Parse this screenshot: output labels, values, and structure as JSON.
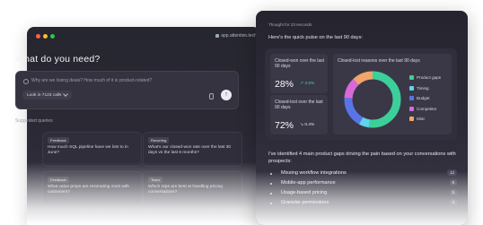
{
  "left_window": {
    "url": "app.attention.tech",
    "heading": "What do you need?",
    "ask_placeholder": "Why are we losing deals? How much of it is product-related?",
    "scope_button": "Look in 7123 calls",
    "send_icon": "arrow-up-icon",
    "suggested_label": "Suggested queries",
    "cards": [
      {
        "tag": "Feedback",
        "text": "How much SQL pipeline have we lost to in June?"
      },
      {
        "tag": "Recurring",
        "text": "What's our closed-won rate over the last 30 days vs the last 6 months?"
      },
      {
        "tag": "Feedback",
        "text": "What value props are resonating most with customers?"
      },
      {
        "tag": "Team",
        "text": "Which reps are best at handling pricing conversations?"
      }
    ]
  },
  "right_window": {
    "thought": "Thought for 23 seconds",
    "intro": "Here's the quick pulse on the last 90 days:",
    "stats": [
      {
        "label": "Closed-won over the last 90 days",
        "value": "28%",
        "delta": "3.5%",
        "delta_dir": "up"
      },
      {
        "label": "Closed-lost over the last 90 days",
        "value": "72%",
        "delta": "0.4%",
        "delta_dir": "down"
      }
    ],
    "summary": "I've identified 4 main product gaps driving the pain based on your conversations with prospects:",
    "gaps": [
      {
        "name": "Missing workflow integrations",
        "badge": "12"
      },
      {
        "name": "Mobile-app performance",
        "badge": "8"
      },
      {
        "name": "Usage-based pricing",
        "badge": "5"
      },
      {
        "name": "Granular permissions",
        "badge": "3"
      }
    ]
  },
  "chart_data": {
    "type": "pie",
    "title": "Closed-lost reasons over the last 90 days",
    "categories": [
      "Product gaps",
      "Timing",
      "Budget",
      "Competitor",
      "Misc"
    ],
    "values": [
      52,
      6,
      18,
      12,
      12
    ],
    "colors": [
      "#3ccf9a",
      "#5fd4ea",
      "#5a74e8",
      "#d86ad8",
      "#f2a56a"
    ],
    "donut": true
  }
}
